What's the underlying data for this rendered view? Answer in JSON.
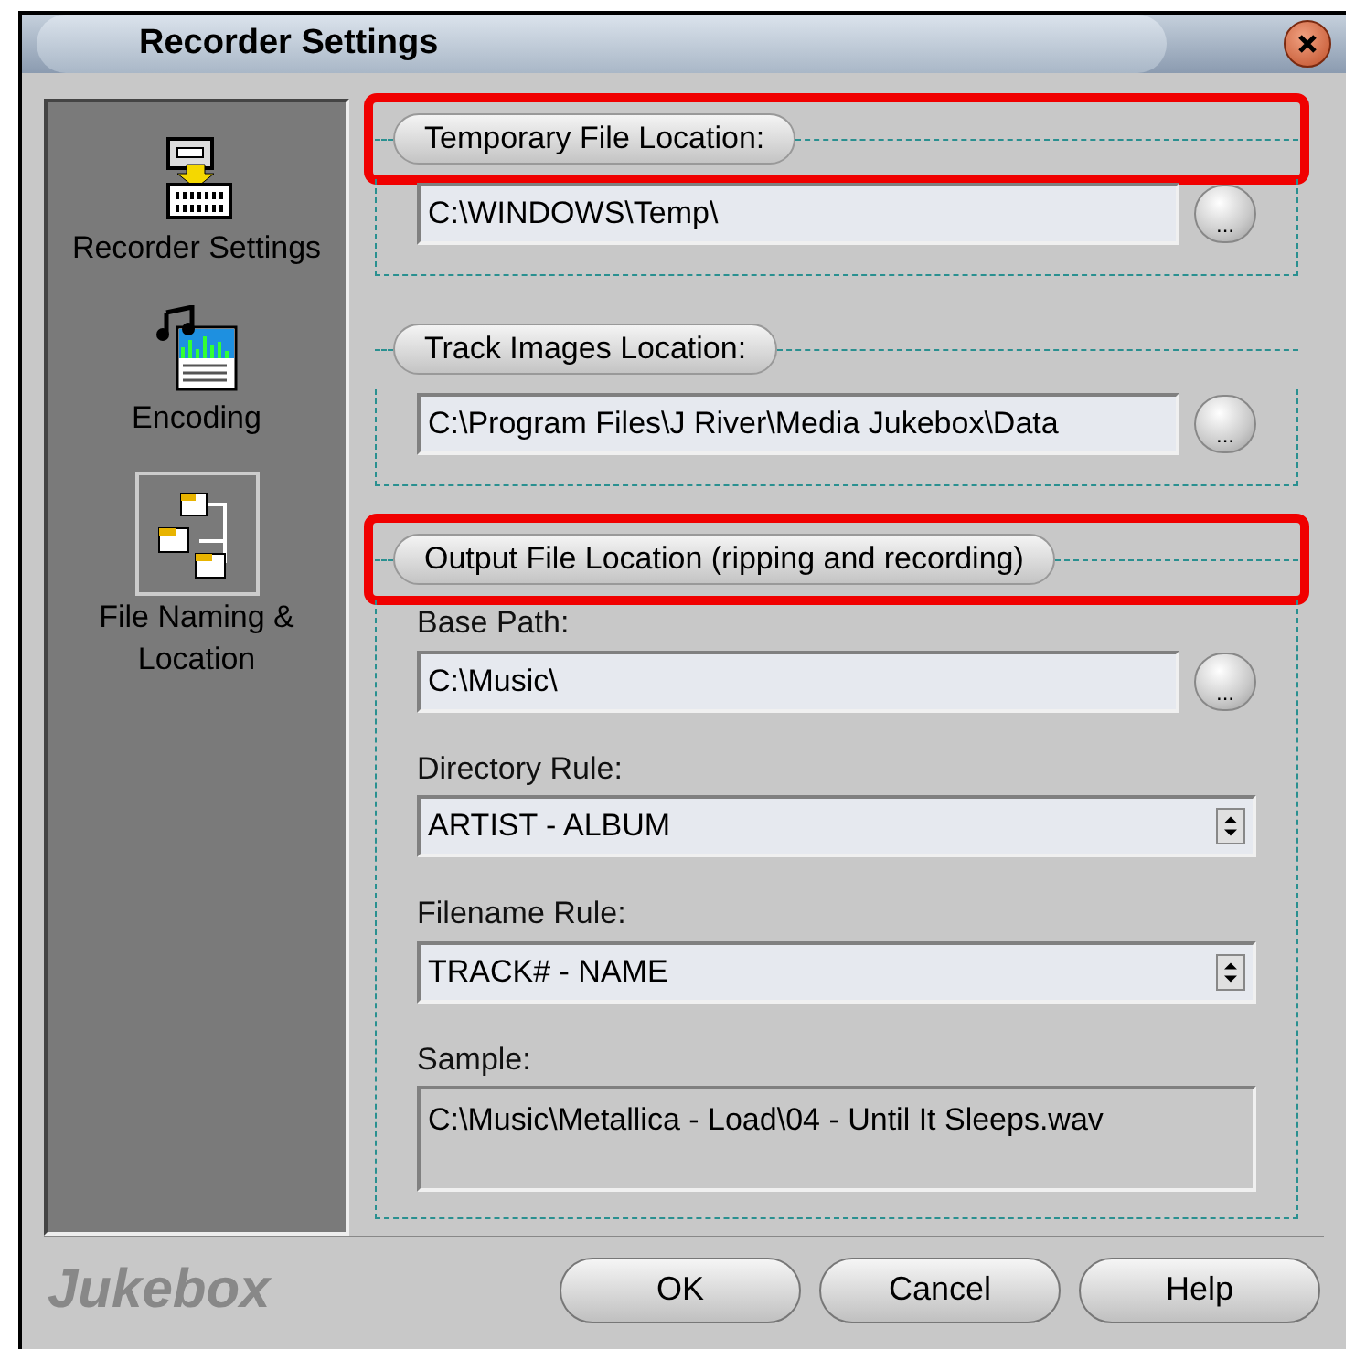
{
  "window": {
    "title": "Recorder Settings"
  },
  "sidebar": {
    "items": [
      {
        "label": "Recorder Settings",
        "kind": "recorder",
        "selected": false
      },
      {
        "label": "Encoding",
        "kind": "encoding",
        "selected": false
      },
      {
        "label": "File Naming & Location",
        "kind": "naming",
        "selected": true
      }
    ]
  },
  "groups": [
    {
      "title": "Temporary File Location:",
      "highlighted": true,
      "fields": [
        {
          "kind": "path",
          "value": "C:\\WINDOWS\\Temp\\",
          "button": "..."
        }
      ]
    },
    {
      "title": "Track Images Location:",
      "highlighted": false,
      "fields": [
        {
          "kind": "path",
          "value": "C:\\Program Files\\J River\\Media Jukebox\\Data",
          "button": "..."
        }
      ]
    },
    {
      "title": "Output File Location (ripping and recording)",
      "highlighted": true,
      "fields": [
        {
          "kind": "path",
          "label": "Base Path:",
          "value": "C:\\Music\\",
          "button": "..."
        },
        {
          "kind": "select",
          "label": "Directory Rule:",
          "value": "ARTIST - ALBUM"
        },
        {
          "kind": "select",
          "label": "Filename Rule:",
          "value": "TRACK# - NAME"
        },
        {
          "kind": "readonly",
          "label": "Sample:",
          "value": "C:\\Music\\Metallica - Load\\04 - Until It Sleeps.wav"
        }
      ]
    }
  ],
  "footer": {
    "brand": "Jukebox",
    "buttons": [
      "OK",
      "Cancel",
      "Help"
    ]
  }
}
